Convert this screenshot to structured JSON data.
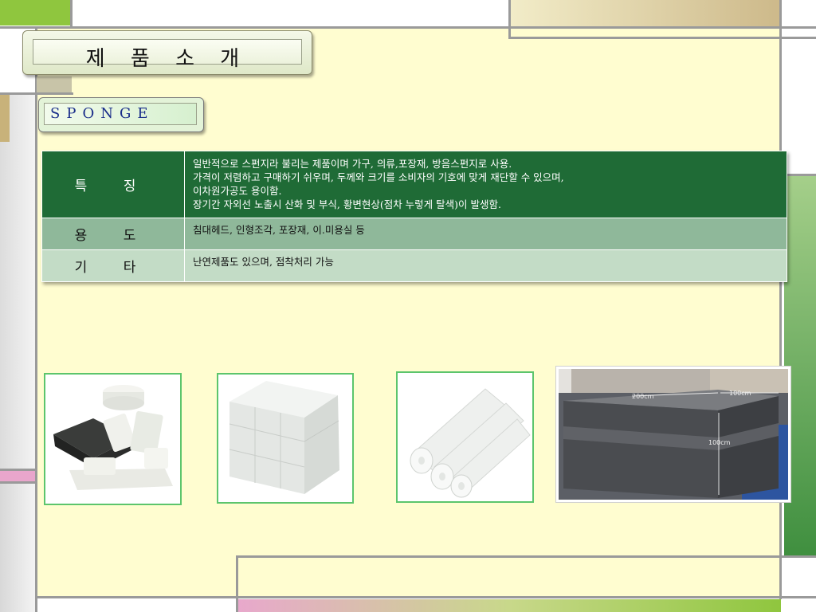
{
  "title": "제 품 소 개",
  "section_label": "SPONGE",
  "table": {
    "rows": [
      {
        "header": "특 징",
        "lines": [
          "일반적으로 스펀지라 불리는 제품이며 가구, 의류,포장재, 방음스펀지로 사용.",
          "가격이 저렴하고 구매하기 쉬우며, 두께와 크기를 소비자의 기호에 맞게 재단할 수 있으며,",
          "이차원가공도  용이함.",
          "장기간 자외선 노출시  산화 및 부식, 황변현상(점차 누렇게 탈색)이 발생함."
        ]
      },
      {
        "header": "용 도",
        "lines": [
          "침대헤드,  인형조각,  포장재,  이.미용실 등"
        ]
      },
      {
        "header": "기 타",
        "lines": [
          "난연제품도 있으며,  점착처리 가능"
        ]
      }
    ]
  },
  "photos": [
    {
      "name": "sponge-blocks-photo"
    },
    {
      "name": "white-sponge-stack-photo"
    },
    {
      "name": "sponge-rolls-photo"
    },
    {
      "name": "foam-block-factory-photo",
      "labels": [
        "200cm",
        "100cm",
        "100cm"
      ]
    }
  ]
}
